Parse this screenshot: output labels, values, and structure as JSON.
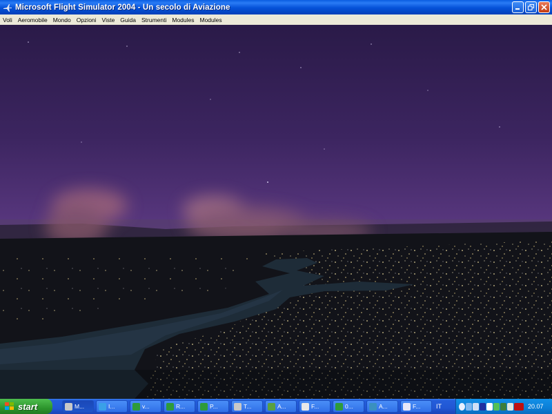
{
  "window": {
    "title": "Microsoft Flight Simulator 2004 - Un secolo di Aviazione",
    "icon": "airplane-icon",
    "buttons": [
      "minimize-icon",
      "restore-icon",
      "close-icon"
    ]
  },
  "menu": [
    "Voli",
    "Aeromobile",
    "Mondo",
    "Opzioni",
    "Viste",
    "Guida",
    "Strumenti",
    "Modules",
    "Modules"
  ],
  "taskbar": {
    "start_label": "start",
    "tasks": [
      {
        "label": "M...",
        "icon": "airplane-icon",
        "color": "#c8c8c8"
      },
      {
        "label": "I...",
        "icon": "ie-icon",
        "color": "#3aa0e8"
      },
      {
        "label": "v...",
        "icon": "excel-icon",
        "color": "#2e9b3a"
      },
      {
        "label": "R...",
        "icon": "excel-icon",
        "color": "#2e9b3a"
      },
      {
        "label": "P...",
        "icon": "excel-icon",
        "color": "#2e9b3a"
      },
      {
        "label": "T...",
        "icon": "airplane-icon",
        "color": "#c8c8c8"
      },
      {
        "label": "A...",
        "icon": "network-icon",
        "color": "#5aa040"
      },
      {
        "label": "F...",
        "icon": "app-window-icon",
        "color": "#e8e8e8"
      },
      {
        "label": "0...",
        "icon": "excel-icon",
        "color": "#2e9b3a"
      },
      {
        "label": "A...",
        "icon": "app-icon",
        "color": "#3a90c0"
      },
      {
        "label": "F...",
        "icon": "document-icon",
        "color": "#e8e8f8"
      }
    ],
    "language": "IT",
    "clock": "20.07"
  }
}
